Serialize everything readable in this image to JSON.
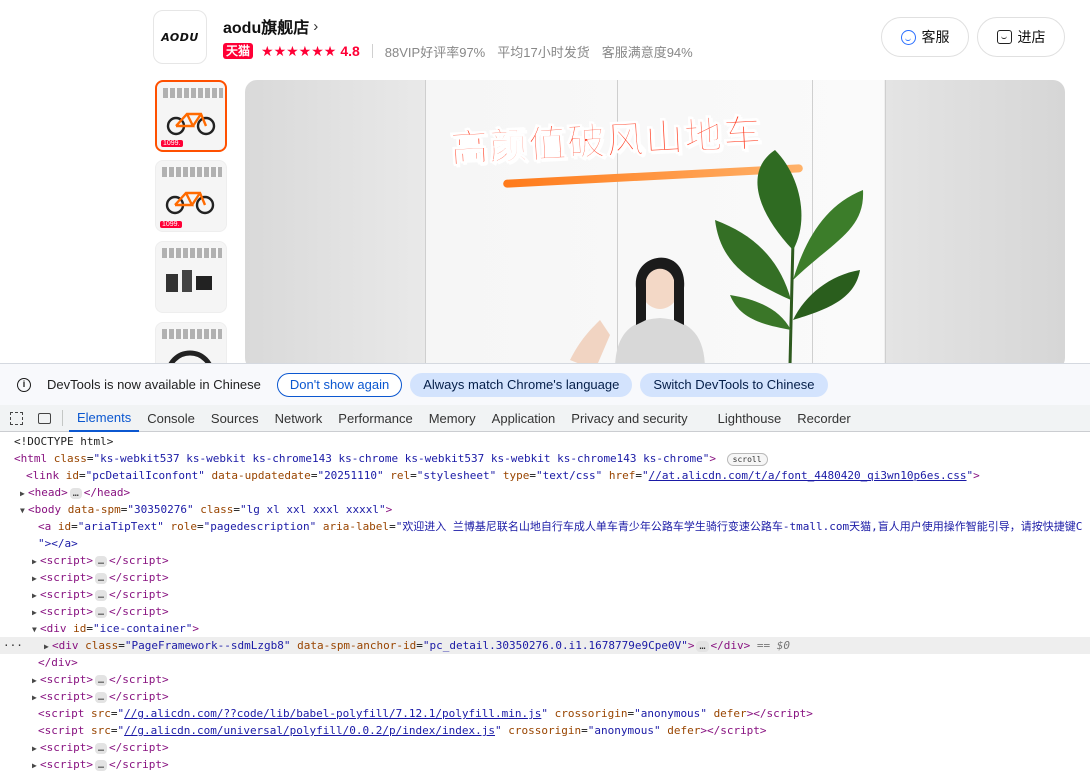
{
  "store": {
    "logo_text": "AODU",
    "name": "aodu旗舰店",
    "chevron": "›",
    "tmall_badge": "天猫",
    "stars": "★★★★★★",
    "score": "4.8",
    "metrics": [
      "88VIP好评率97%",
      "平均17小时发货",
      "客服满意度94%"
    ],
    "customer_service_label": "客服",
    "enter_store_label": "进店"
  },
  "thumbnails": [
    {
      "price": "1099."
    },
    {
      "price": "1099."
    },
    {
      "price": ""
    },
    {
      "price": ""
    }
  ],
  "media": {
    "headline": "高颜值破风山地车"
  },
  "devtools": {
    "infobar": {
      "message": "DevTools is now available in Chinese",
      "dont_show": "Don't show again",
      "always_match": "Always match Chrome's language",
      "switch_lang": "Switch DevTools to Chinese"
    },
    "tabs": [
      "Elements",
      "Console",
      "Sources",
      "Network",
      "Performance",
      "Memory",
      "Application",
      "Privacy and security",
      "Lighthouse",
      "Recorder"
    ],
    "active_tab": "Elements",
    "elements": {
      "doctype": "<!DOCTYPE html>",
      "html_class": "ks-webkit537 ks-webkit ks-chrome143 ks-chrome ks-webkit537 ks-webkit ks-chrome143 ks-chrome",
      "scroll_badge": "scroll",
      "link_id": "pcDetailIconfont",
      "link_updatedate": "20251110",
      "link_rel": "stylesheet",
      "link_type": "text/css",
      "link_href": "//at.alicdn.com/t/a/font_4480420_qi3wn10p6es.css",
      "body_spm": "30350276",
      "body_class": "lg xl xxl xxxl xxxxl",
      "a_id": "ariaTipText",
      "a_role": "pagedescription",
      "a_label": "欢迎进入 兰博基尼联名山地自行车成人单车青少年公路车学生骑行变速公路车-tmall.com天猫,盲人用户使用操作智能引导，请按快捷键C",
      "a_close": "\"></a>",
      "div_id": "ice-container",
      "inner_div_class": "PageFramework--sdmLzgb8",
      "inner_div_anchor": "pc_detail.30350276.0.i1.1678779e9Cpe0V",
      "dollar": "== $0",
      "script1_src": "//g.alicdn.com/??code/lib/babel-polyfill/7.12.1/polyfill.min.js",
      "script2_src": "//g.alicdn.com/universal/polyfill/0.0.2/p/index/index.js",
      "crossorigin": "anonymous",
      "defer": "defer",
      "ellipsis": "…",
      "row_dots": "···"
    }
  }
}
